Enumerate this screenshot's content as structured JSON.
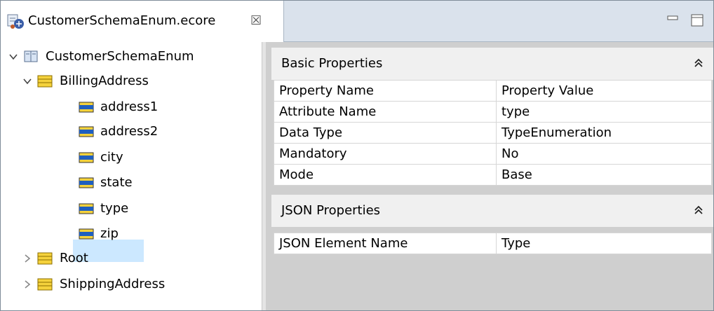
{
  "tab": {
    "title": "CustomerSchemaEnum.ecore",
    "close_icon": "close-icon",
    "minimize_icon": "minimize-icon",
    "maximize_icon": "maximize-icon"
  },
  "tree": {
    "root": {
      "label": "CustomerSchemaEnum",
      "expanded": true,
      "icon": "book-icon"
    },
    "billing": {
      "label": "BillingAddress",
      "expanded": true,
      "icon": "class-icon"
    },
    "attributes": [
      {
        "label": "address1",
        "icon": "attribute-icon"
      },
      {
        "label": "address2",
        "icon": "attribute-icon"
      },
      {
        "label": "city",
        "icon": "attribute-icon"
      },
      {
        "label": "state",
        "icon": "attribute-icon"
      },
      {
        "label": "type",
        "icon": "attribute-icon",
        "selected": true
      },
      {
        "label": "zip",
        "icon": "attribute-icon"
      }
    ],
    "root_class": {
      "label": "Root",
      "expanded": false,
      "icon": "class-icon"
    },
    "shipping": {
      "label": "ShippingAddress",
      "expanded": false,
      "icon": "class-icon"
    }
  },
  "basic": {
    "title": "Basic Properties",
    "header": [
      "Property Name",
      "Property Value"
    ],
    "rows": [
      [
        "Attribute Name",
        "type"
      ],
      [
        "Data Type",
        "TypeEnumeration"
      ],
      [
        "Mandatory",
        "No"
      ],
      [
        "Mode",
        "Base"
      ]
    ]
  },
  "json": {
    "title": "JSON Properties",
    "rows": [
      [
        "JSON Element Name",
        "Type"
      ]
    ]
  },
  "colors": {
    "tabbar": "#dae2ec",
    "selection": "#cce8ff",
    "section_header": "#f0f0f0",
    "empty_area": "#cfcfcf",
    "class_icon_fill": "#f5d23c",
    "attribute_icon_fill": "#1f5fbf"
  }
}
